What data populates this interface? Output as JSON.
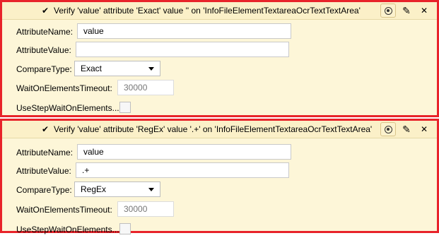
{
  "labels": {
    "attribute_name": "AttributeName:",
    "attribute_value": "AttributeValue:",
    "compare_type": "CompareType:",
    "wait_timeout": "WaitOnElementsTimeout:",
    "use_step_wait": "UseStepWaitOnElements..."
  },
  "icons": {
    "check": "✔",
    "info": "info-icon",
    "edit": "✎",
    "close": "✕"
  },
  "steps": [
    {
      "title": "Verify 'value' attribute 'Exact' value '' on 'InfoFileElementTextareaOcrTextTextArea'",
      "attribute_name": "value",
      "attribute_value": "",
      "compare_type": "Exact",
      "wait_timeout": "30000",
      "use_step_wait_checked": false
    },
    {
      "title": "Verify 'value' attribute 'RegEx' value '.+' on 'InfoFileElementTextareaOcrTextTextArea'",
      "attribute_name": "value",
      "attribute_value": ".+",
      "compare_type": "RegEx",
      "wait_timeout": "30000",
      "use_step_wait_checked": false
    }
  ]
}
